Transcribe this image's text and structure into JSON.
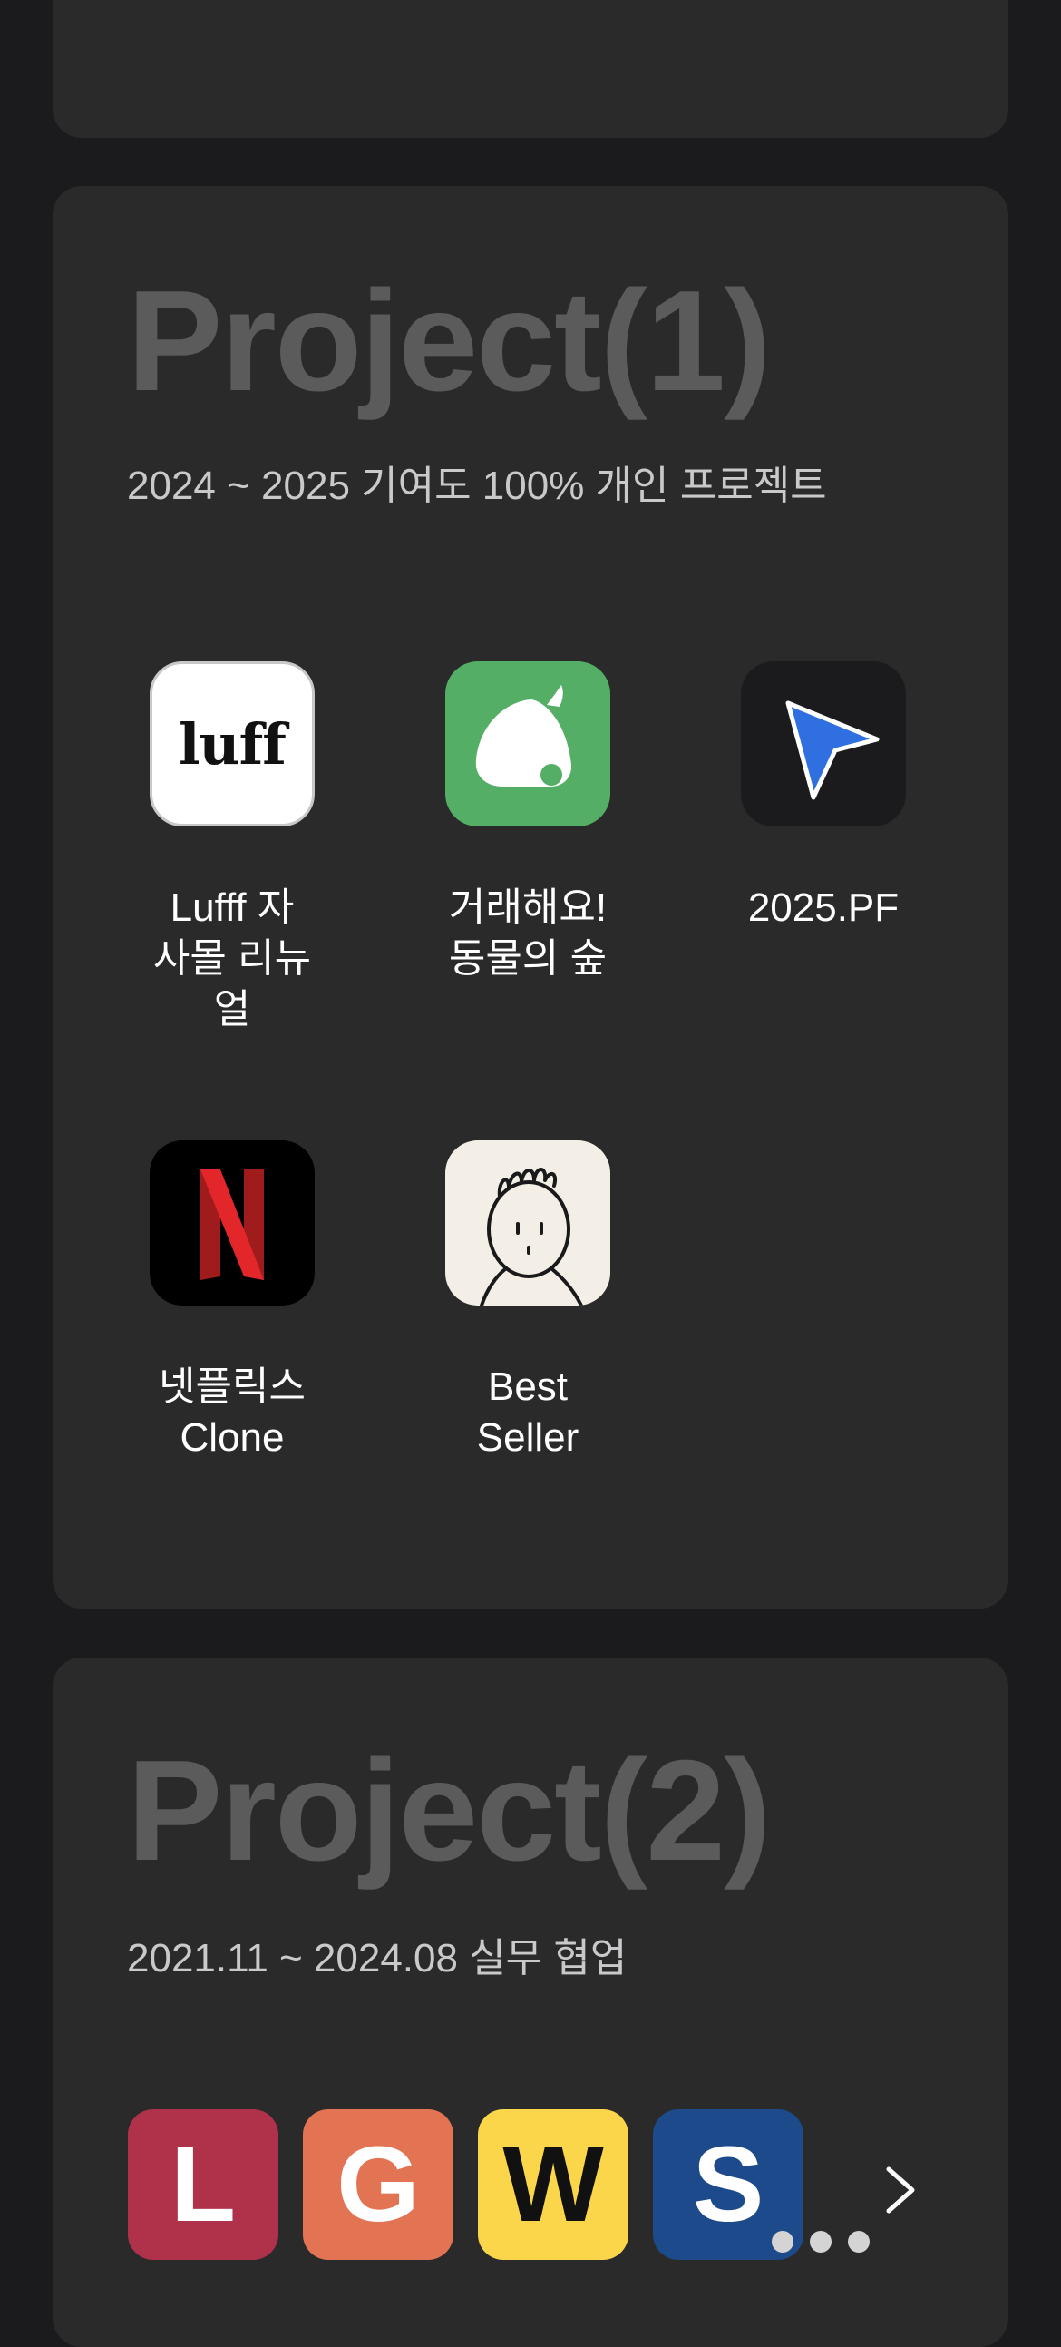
{
  "project1": {
    "title": "Project(1)",
    "subtitle": "2024 ~ 2025 기여도 100% 개인 프로젝트",
    "apps": [
      {
        "label": "Lufff 자\n사몰 리뉴\n얼",
        "icon": "luff-logo-icon",
        "icon_text": "luff"
      },
      {
        "label": "거래해요!\n동물의 숲",
        "icon": "leaf-icon"
      },
      {
        "label": "2025.PF",
        "icon": "cursor-arrow-icon"
      },
      {
        "label": "넷플릭스\nClone",
        "icon": "netflix-logo-icon"
      },
      {
        "label": "Best\nSeller",
        "icon": "doodle-face-icon"
      }
    ]
  },
  "project2": {
    "title": "Project(2)",
    "subtitle": "2021.11 ~ 2024.08 실무 협업",
    "badges": [
      {
        "letter": "L",
        "bg": "#b0324a",
        "fg": "#ffffff"
      },
      {
        "letter": "G",
        "bg": "#e27353",
        "fg": "#ffffff"
      },
      {
        "letter": "W",
        "bg": "#fbd64a",
        "fg": "#111111"
      },
      {
        "letter": "S",
        "bg": "#1d4a8a",
        "fg": "#ffffff"
      }
    ]
  },
  "colors": {
    "page_bg": "#1b1b1e",
    "card_bg": "#2a2a2b",
    "title": "#5b5b5c",
    "subtitle": "#c9c9cb"
  }
}
